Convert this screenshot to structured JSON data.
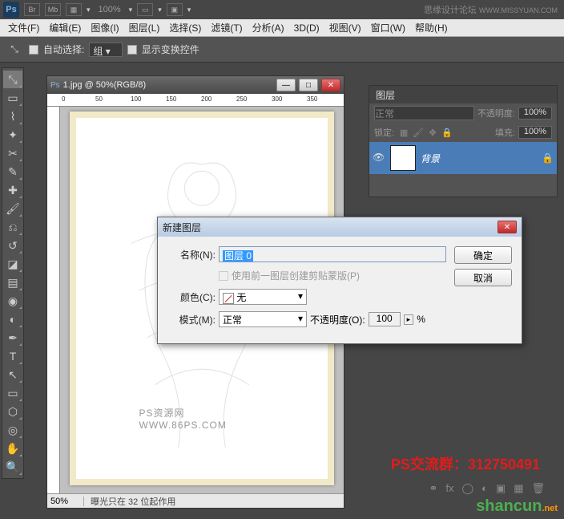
{
  "app": {
    "logo": "Ps",
    "zoom": "100%"
  },
  "watermark_top": {
    "text": "思缘设计论坛",
    "url": "WWW.MISSYUAN.COM"
  },
  "menu": [
    "文件(F)",
    "编辑(E)",
    "图像(I)",
    "图层(L)",
    "选择(S)",
    "滤镜(T)",
    "分析(A)",
    "3D(D)",
    "视图(V)",
    "窗口(W)",
    "帮助(H)"
  ],
  "options": {
    "auto_select_label": "自动选择:",
    "auto_select_value": "组",
    "show_transform_label": "显示变换控件"
  },
  "document": {
    "title": "1.jpg @ 50%(RGB/8)",
    "ruler_marks": [
      "0",
      "50",
      "100",
      "150",
      "200",
      "250",
      "300",
      "350"
    ],
    "zoom": "50%",
    "status": "曝光只在 32 位起作用",
    "artwork_caption": "PS资源网  WWW.86PS.COM"
  },
  "layers_panel": {
    "tab": "图层",
    "blend_mode": "正常",
    "opacity_label": "不透明度:",
    "opacity_value": "100%",
    "lock_label": "锁定:",
    "fill_label": "填充:",
    "fill_value": "100%",
    "layer": {
      "name": "背景"
    }
  },
  "dialog": {
    "title": "新建图层",
    "name_label": "名称(N):",
    "name_value": "图层 0",
    "clip_label": "使用前一图层创建剪贴蒙版(P)",
    "color_label": "颜色(C):",
    "color_value": "无",
    "mode_label": "模式(M):",
    "mode_value": "正常",
    "opacity_label": "不透明度(O):",
    "opacity_value": "100",
    "opacity_unit": "%",
    "ok": "确定",
    "cancel": "取消"
  },
  "overlay": {
    "red_text": "PS交流群：312750491",
    "brand": "shancun",
    "brand_suffix": ".net"
  }
}
